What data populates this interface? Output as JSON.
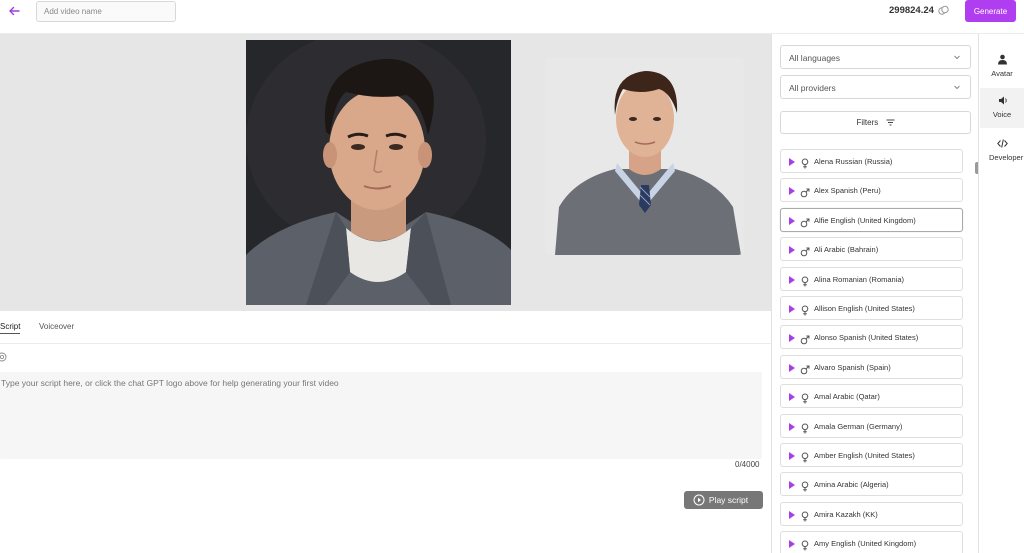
{
  "topbar": {
    "video_name_placeholder": "Add video name",
    "credits": "299824.24",
    "generate_label": "Generate",
    "accent": "#b13df0"
  },
  "editor": {
    "tabs": [
      {
        "label": "Script",
        "active": true
      },
      {
        "label": "Voiceover",
        "active": false
      }
    ],
    "script_placeholder": "Type your script here, or click the chat GPT logo above for help generating your first video",
    "char_count": "0/4000",
    "play_script_label": "Play script"
  },
  "panel": {
    "language_select": "All languages",
    "provider_select": "All providers",
    "filters_label": "Filters",
    "voices": [
      {
        "name": "Alena  Russian (Russia)",
        "gender": "female"
      },
      {
        "name": "Alex  Spanish (Peru)",
        "gender": "male"
      },
      {
        "name": "Alfie  English (United Kingdom)",
        "gender": "male"
      },
      {
        "name": "Ali  Arabic (Bahrain)",
        "gender": "male"
      },
      {
        "name": "Alina  Romanian (Romania)",
        "gender": "female"
      },
      {
        "name": "Allison  English (United States)",
        "gender": "female"
      },
      {
        "name": "Alonso  Spanish (United States)",
        "gender": "male"
      },
      {
        "name": "Alvaro  Spanish (Spain)",
        "gender": "male"
      },
      {
        "name": "Amal  Arabic (Qatar)",
        "gender": "female"
      },
      {
        "name": "Amala  German (Germany)",
        "gender": "female"
      },
      {
        "name": "Amber  English (United States)",
        "gender": "female"
      },
      {
        "name": "Amina  Arabic (Algeria)",
        "gender": "female"
      },
      {
        "name": "Amira  Kazakh (KK)",
        "gender": "female"
      },
      {
        "name": "Amy  English (United Kingdom)",
        "gender": "female"
      }
    ]
  },
  "side_tabs": [
    {
      "label": "Avatar",
      "icon": "person-icon",
      "active": false
    },
    {
      "label": "Voice",
      "icon": "voice-icon",
      "active": true
    },
    {
      "label": "Developer",
      "icon": "code-icon",
      "active": false
    }
  ]
}
